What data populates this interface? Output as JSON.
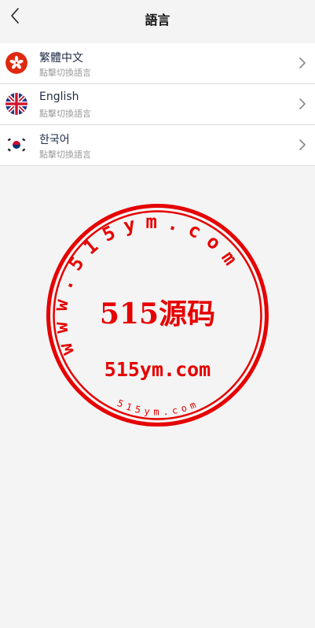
{
  "header": {
    "title": "語言",
    "back_icon": "chevron-left-icon"
  },
  "languages": [
    {
      "name": "繁體中文",
      "hint": "點擊切換語言",
      "flag": "hong-kong-flag-icon"
    },
    {
      "name": "English",
      "hint": "點擊切換語言",
      "flag": "uk-flag-icon"
    },
    {
      "name": "한국어",
      "hint": "點擊切換語言",
      "flag": "south-korea-flag-icon"
    }
  ],
  "watermark": {
    "top_arc": "www.515ym.com",
    "center": "515源码",
    "url": "515ym.com",
    "bottom_arc": "515ym.com",
    "color": "#e60000"
  },
  "colors": {
    "background": "#f4f4f4",
    "item_text": "#1d2b44",
    "hint_text": "#9a9a9a"
  }
}
